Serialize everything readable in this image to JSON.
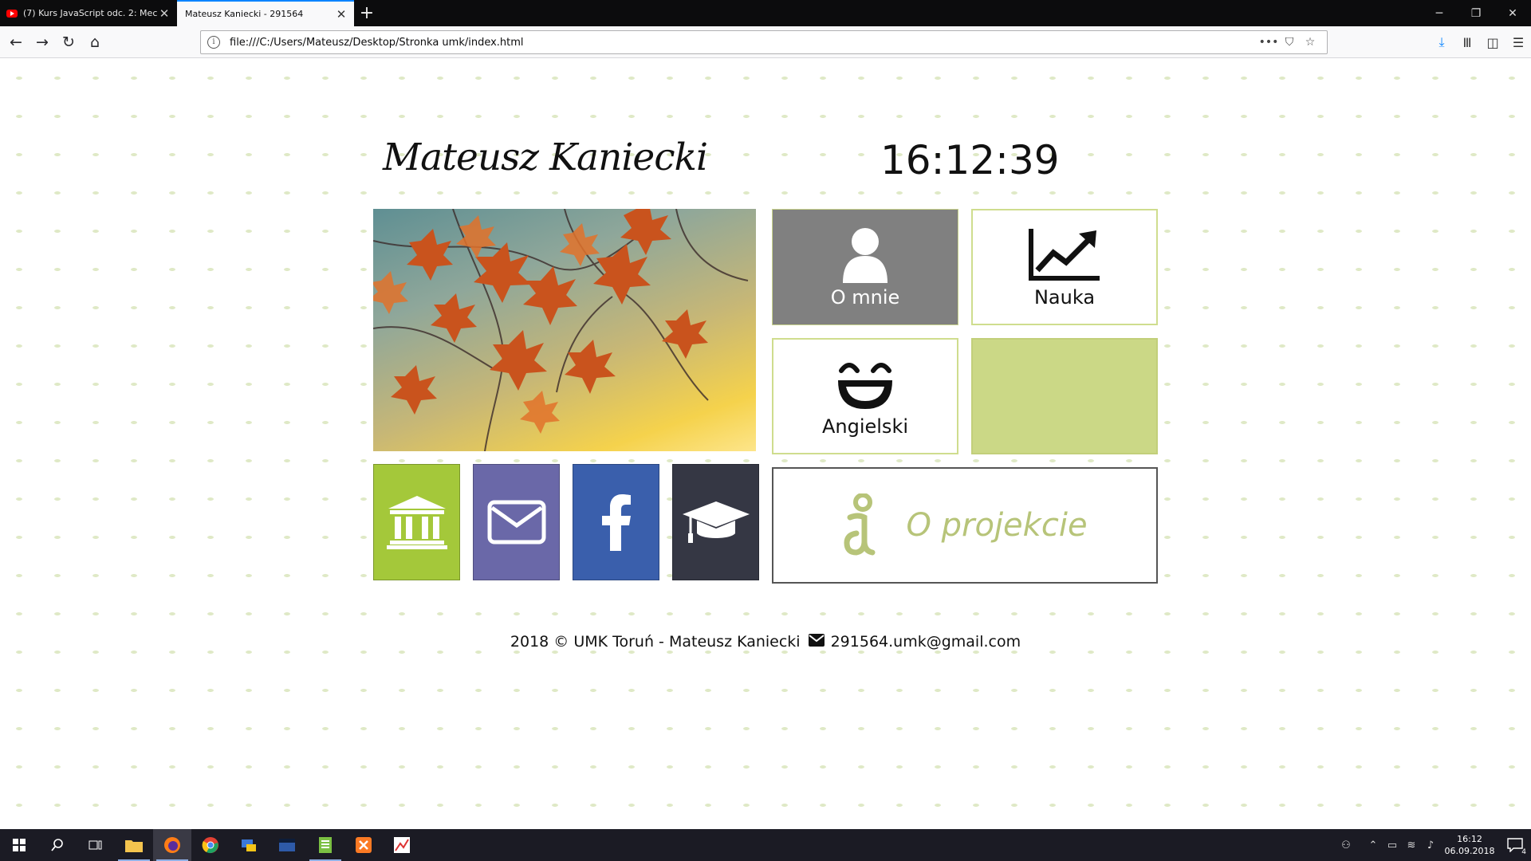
{
  "browser": {
    "tabs": [
      {
        "title": "(7) Kurs JavaScript odc. 2: Mech",
        "icon": "youtube-icon",
        "active": false
      },
      {
        "title": "Mateusz Kaniecki - 291564",
        "icon": "",
        "active": true
      }
    ],
    "url": "file:///C:/Users/Mateusz/Desktop/Stronka umk/index.html"
  },
  "page": {
    "name": "Mateusz Kaniecki",
    "clock": "16:12:39",
    "tiles": {
      "omnie": "O mnie",
      "nauka": "Nauka",
      "angielski": "Angielski"
    },
    "oprojekcie": "O projekcie",
    "footer": {
      "left": "2018 © UMK Toruń - Mateusz Kaniecki",
      "email": "291564.umk@gmail.com"
    },
    "colors": {
      "green": "#a4c83a",
      "lilac": "#6a68a8",
      "facebook": "#3a5fac",
      "dark": "#353744",
      "olive": "#cbd886"
    }
  },
  "taskbar": {
    "time": "16:12",
    "date": "06.09.2018",
    "notifications": "4"
  }
}
